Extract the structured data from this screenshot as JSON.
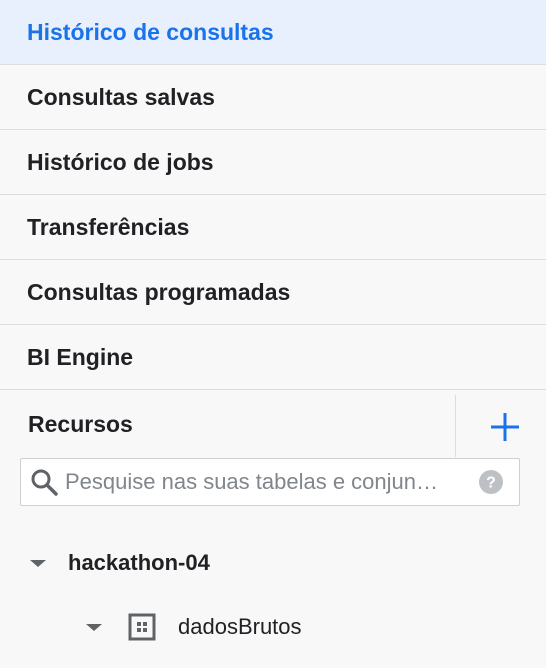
{
  "nav": {
    "items": [
      {
        "label": "Histórico de consultas",
        "active": true
      },
      {
        "label": "Consultas salvas",
        "active": false
      },
      {
        "label": "Histórico de jobs",
        "active": false
      },
      {
        "label": "Transferências",
        "active": false
      },
      {
        "label": "Consultas programadas",
        "active": false
      },
      {
        "label": "BI Engine",
        "active": false
      }
    ]
  },
  "resources": {
    "title": "Recursos",
    "add_icon": "plus-icon",
    "search": {
      "placeholder": "Pesquise nas suas tabelas e conjun…",
      "value": "",
      "search_icon": "search-icon",
      "help_icon": "help-icon"
    },
    "tree": {
      "project": {
        "label": "hackathon-04",
        "expanded": true
      },
      "dataset": {
        "label": "dadosBrutos",
        "expanded": true,
        "icon": "dataset-icon"
      }
    }
  },
  "colors": {
    "accent": "#1a73e8",
    "active_bg": "#e8f0fe",
    "panel_bg": "#f8f8f8",
    "divider": "#dcdcdc",
    "icon_gray": "#5f6368"
  }
}
